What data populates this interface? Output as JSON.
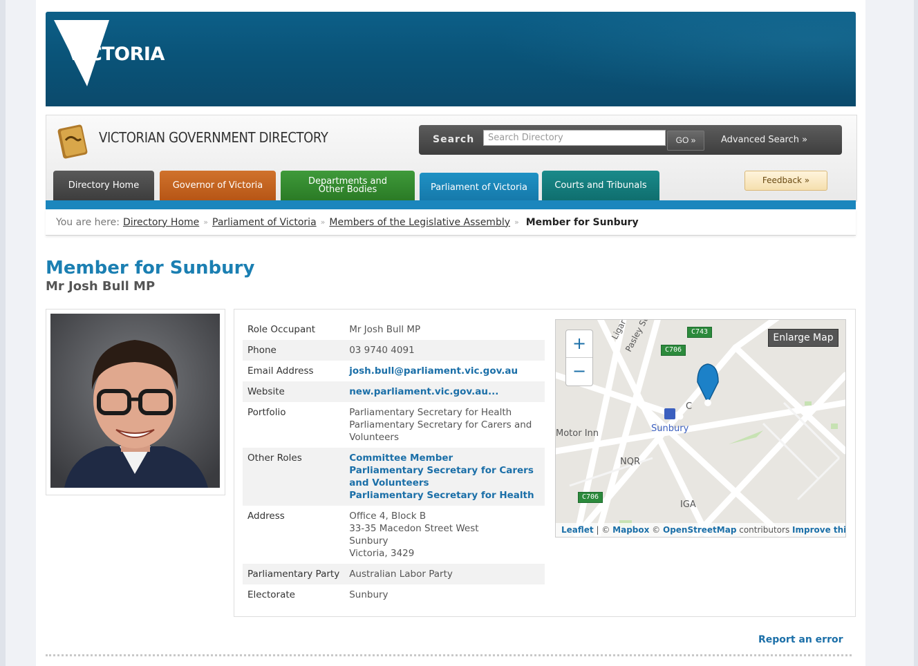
{
  "banner": {
    "logo_text": "VICTORIA"
  },
  "header": {
    "title": "VICTORIAN GOVERNMENT DIRECTORY",
    "search_label": "Search",
    "search_placeholder": "Search Directory",
    "go_label": "GO »",
    "advanced_label": "Advanced Search »",
    "feedback_label": "Feedback »"
  },
  "tabs": [
    {
      "label": "Directory Home"
    },
    {
      "label": "Governor of Victoria"
    },
    {
      "label_line1": "Departments and",
      "label_line2": "Other Bodies"
    },
    {
      "label": "Parliament of Victoria"
    },
    {
      "label": "Courts and Tribunals"
    }
  ],
  "breadcrumb": {
    "prefix": "You are here:",
    "items": [
      "Directory Home",
      "Parliament of Victoria",
      "Members of the Legislative Assembly"
    ],
    "separator": "»",
    "current": "Member for Sunbury"
  },
  "page": {
    "title": "Member for Sunbury",
    "subtitle": "Mr Josh Bull MP"
  },
  "details": {
    "role_occupant": {
      "label": "Role Occupant",
      "value": "Mr Josh Bull MP"
    },
    "phone": {
      "label": "Phone",
      "value": "03 9740 4091"
    },
    "email": {
      "label": "Email Address",
      "value": "josh.bull@parliament.vic.gov.au"
    },
    "website": {
      "label": "Website",
      "value": "new.parliament.vic.gov.au..."
    },
    "portfolio": {
      "label": "Portfolio",
      "line1": "Parliamentary Secretary for Health",
      "line2": "Parliamentary Secretary for Carers and Volunteers"
    },
    "other_roles": {
      "label": "Other Roles",
      "items": [
        "Committee Member",
        "Parliamentary Secretary for Carers and Volunteers",
        "Parliamentary Secretary for Health"
      ]
    },
    "address": {
      "label": "Address",
      "lines": [
        "Office 4, Block B",
        "33-35 Macedon Street West",
        "Sunbury",
        "Victoria, 3429"
      ]
    },
    "party": {
      "label": "Parliamentary Party",
      "value": "Australian Labor Party"
    },
    "electorate": {
      "label": "Electorate",
      "value": "Sunbury"
    }
  },
  "map": {
    "enlarge_label": "Enlarge Map",
    "zoom_in": "+",
    "zoom_out": "−",
    "labels": {
      "sunbury": "Sunbury",
      "motor_inn": "Motor Inn",
      "nqr": "NQR",
      "iga": "IGA",
      "pasley": "Pasley St",
      "ligar": "Ligar",
      "c_label": "C"
    },
    "road_badges": [
      "C743",
      "C706",
      "C706"
    ],
    "attribution": {
      "leaflet": "Leaflet",
      "sep1": " | © ",
      "mapbox": "Mapbox",
      "sep2": " © ",
      "osm": "OpenStreetMap",
      "contributors": " contributors ",
      "improve": "Improve this map"
    }
  },
  "footer": {
    "report_label": "Report an error"
  }
}
